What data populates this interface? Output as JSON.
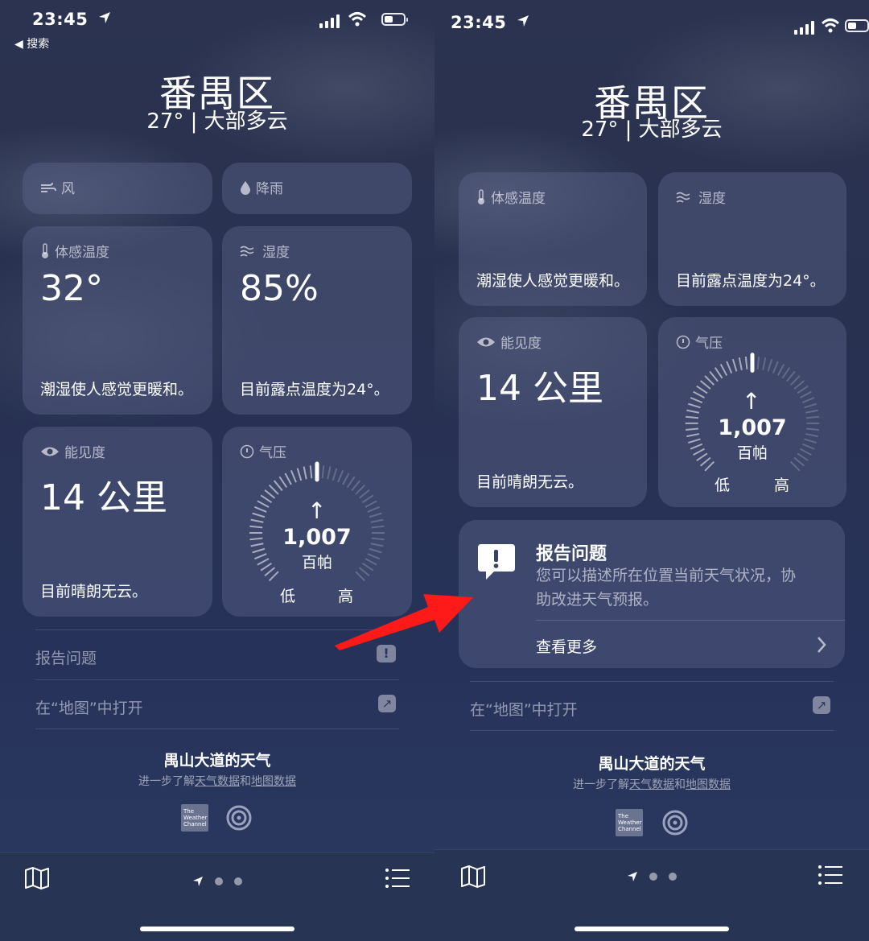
{
  "status": {
    "time": "23:45",
    "back_label": "◀ 搜索"
  },
  "location": {
    "city": "番禺区",
    "condition": "27° | 大部多云"
  },
  "cards": {
    "wind": {
      "title": "风"
    },
    "rain": {
      "title": "降雨"
    },
    "feels_like": {
      "title": "体感温度",
      "value": "32°",
      "desc": "潮湿使人感觉更暖和。"
    },
    "humidity": {
      "title": "湿度",
      "value": "85%",
      "desc": "目前露点温度为24°。"
    },
    "visibility": {
      "title": "能见度",
      "value": "14 公里",
      "desc": "目前晴朗无云。"
    },
    "pressure": {
      "title": "气压",
      "value": "1,007",
      "unit": "百帕",
      "low": "低",
      "high": "高",
      "fill_fraction": 0.5
    }
  },
  "links": {
    "report": "报告问题",
    "open_maps": "在“地图”中打开"
  },
  "report_card": {
    "title": "报告问题",
    "desc": "您可以描述所在位置当前天气状况，协助改进天气预报。",
    "more": "查看更多"
  },
  "footer": {
    "title": "禺山大道的天气",
    "sub_prefix": "进一步了解",
    "sub_link1": "天气数据",
    "sub_mid": "和",
    "sub_link2": "地图数据",
    "twc_logo": "The Weather Channel"
  },
  "colors": {
    "accent_red": "#ff1a1a"
  }
}
